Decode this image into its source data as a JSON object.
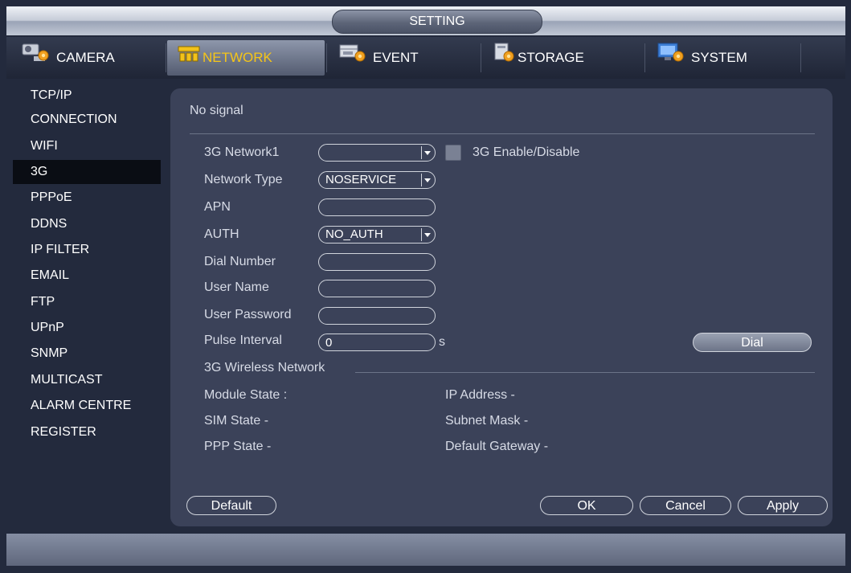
{
  "window": {
    "title": "SETTING"
  },
  "tabs": [
    {
      "label": "CAMERA",
      "icon": "camera-icon",
      "active": false
    },
    {
      "label": "NETWORK",
      "icon": "network-icon",
      "active": true
    },
    {
      "label": "EVENT",
      "icon": "event-icon",
      "active": false
    },
    {
      "label": "STORAGE",
      "icon": "storage-icon",
      "active": false
    },
    {
      "label": "SYSTEM",
      "icon": "system-icon",
      "active": false
    }
  ],
  "sidebar": {
    "items": [
      "TCP/IP",
      "CONNECTION",
      "WIFI",
      "3G",
      "PPPoE",
      "DDNS",
      "IP FILTER",
      "EMAIL",
      "FTP",
      "UPnP",
      "SNMP",
      "MULTICAST",
      "ALARM CENTRE",
      "REGISTER"
    ],
    "active": "3G"
  },
  "panel": {
    "signal_status": "No signal",
    "network_label": "3G Network1",
    "network_value": "",
    "enable_label": "3G Enable/Disable",
    "enable_checked": false,
    "network_type_label": "Network Type",
    "network_type_value": "NOSERVICE",
    "apn_label": "APN",
    "apn_value": "",
    "auth_label": "AUTH",
    "auth_value": "NO_AUTH",
    "dial_number_label": "Dial Number",
    "dial_number_value": "",
    "user_name_label": "User Name",
    "user_name_value": "",
    "user_password_label": "User Password",
    "user_password_value": "",
    "pulse_interval_label": "Pulse Interval",
    "pulse_interval_value": "0",
    "pulse_interval_unit": "s",
    "dial_button": "Dial",
    "wireless_section_title": "3G Wireless Network",
    "module_state_label": "Module State :",
    "sim_state_label": "SIM State -",
    "ppp_state_label": "PPP State -",
    "ip_address_label": "IP Address -",
    "subnet_mask_label": "Subnet Mask -",
    "default_gateway_label": "Default Gateway -"
  },
  "footer": {
    "default_button": "Default",
    "ok_button": "OK",
    "cancel_button": "Cancel",
    "apply_button": "Apply"
  },
  "colors": {
    "background": "#232a3d",
    "panel": "#3b4259",
    "active_tab_text": "#f5c518",
    "text": "#d7dbe6"
  }
}
